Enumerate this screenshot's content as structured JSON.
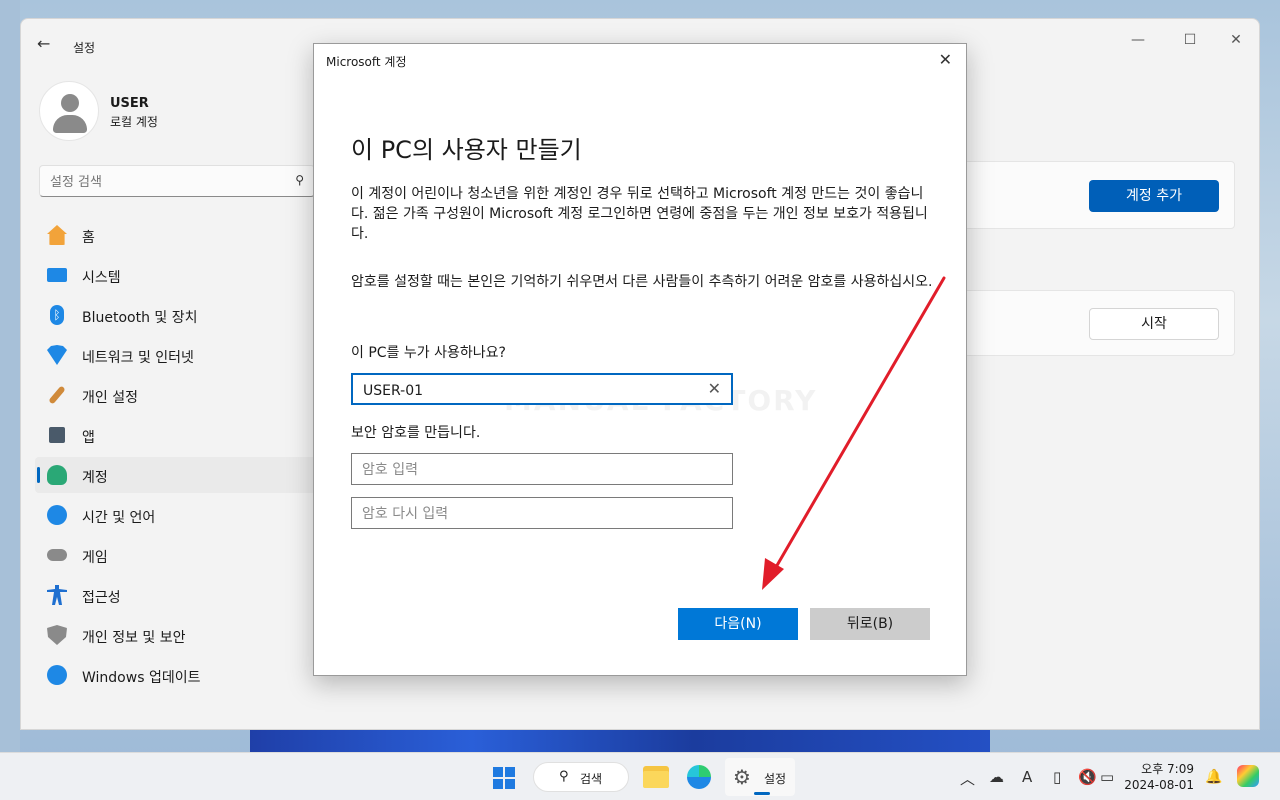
{
  "window": {
    "app_title": "설정",
    "back_icon": "arrow-left-icon",
    "controls": {
      "minimize": "—",
      "maximize": "☐",
      "close": "✕"
    }
  },
  "user": {
    "name": "USER",
    "type": "로컬 계정"
  },
  "search": {
    "placeholder": "설정 검색",
    "icon": "🔍"
  },
  "sidebar": {
    "items": [
      {
        "label": "홈",
        "icon": "home-icon",
        "color": "#f2a33a",
        "active": false
      },
      {
        "label": "시스템",
        "icon": "monitor-icon",
        "color": "#1e88e5",
        "active": false
      },
      {
        "label": "Bluetooth 및 장치",
        "icon": "bluetooth-icon",
        "color": "#1e88e5",
        "active": false
      },
      {
        "label": "네트워크 및 인터넷",
        "icon": "wifi-icon",
        "color": "#1e88e5",
        "active": false
      },
      {
        "label": "개인 설정",
        "icon": "brush-icon",
        "color": "#d08a3a",
        "active": false
      },
      {
        "label": "앱",
        "icon": "apps-icon",
        "color": "#4a5a6a",
        "active": false
      },
      {
        "label": "계정",
        "icon": "person-icon",
        "color": "#2aa876",
        "active": true
      },
      {
        "label": "시간 및 언어",
        "icon": "globe-clock-icon",
        "color": "#1e88e5",
        "active": false
      },
      {
        "label": "게임",
        "icon": "gamepad-icon",
        "color": "#8a8a8a",
        "active": false
      },
      {
        "label": "접근성",
        "icon": "accessibility-icon",
        "color": "#1e6fd0",
        "active": false
      },
      {
        "label": "개인 정보 및 보안",
        "icon": "shield-icon",
        "color": "#8a8a8a",
        "active": false
      },
      {
        "label": "Windows 업데이트",
        "icon": "update-icon",
        "color": "#1e88e5",
        "active": false
      }
    ]
  },
  "main": {
    "add_account_label": "계정 추가",
    "start_label": "시작"
  },
  "dialog": {
    "title": "Microsoft 계정",
    "heading": "이 PC의 사용자 만들기",
    "para1": "이 계정이 어린이나 청소년을 위한 계정인 경우 뒤로 선택하고 Microsoft 계정 만드는 것이 좋습니다. 젊은 가족 구성원이 Microsoft 계정 로그인하면 연령에 중점을 두는 개인 정보 보호가 적용됩니다.",
    "para2": "암호를 설정할 때는 본인은 기억하기 쉬우면서 다른 사람들이 추측하기 어려운 암호를 사용하십시오.",
    "who_label": "이 PC를 누가 사용하나요?",
    "username_value": "USER-01",
    "password_section_label": "보안 암호를 만듭니다.",
    "password_placeholder": "암호 입력",
    "password_confirm_placeholder": "암호 다시 입력",
    "next_label": "다음(N)",
    "back_label": "뒤로(B)",
    "watermark": "MANUAL FACTORY"
  },
  "taskbar": {
    "search_label": "검색",
    "settings_app_label": "설정",
    "time": "오후 7:09",
    "date": "2024-08-01",
    "accent": "#0067c0"
  }
}
